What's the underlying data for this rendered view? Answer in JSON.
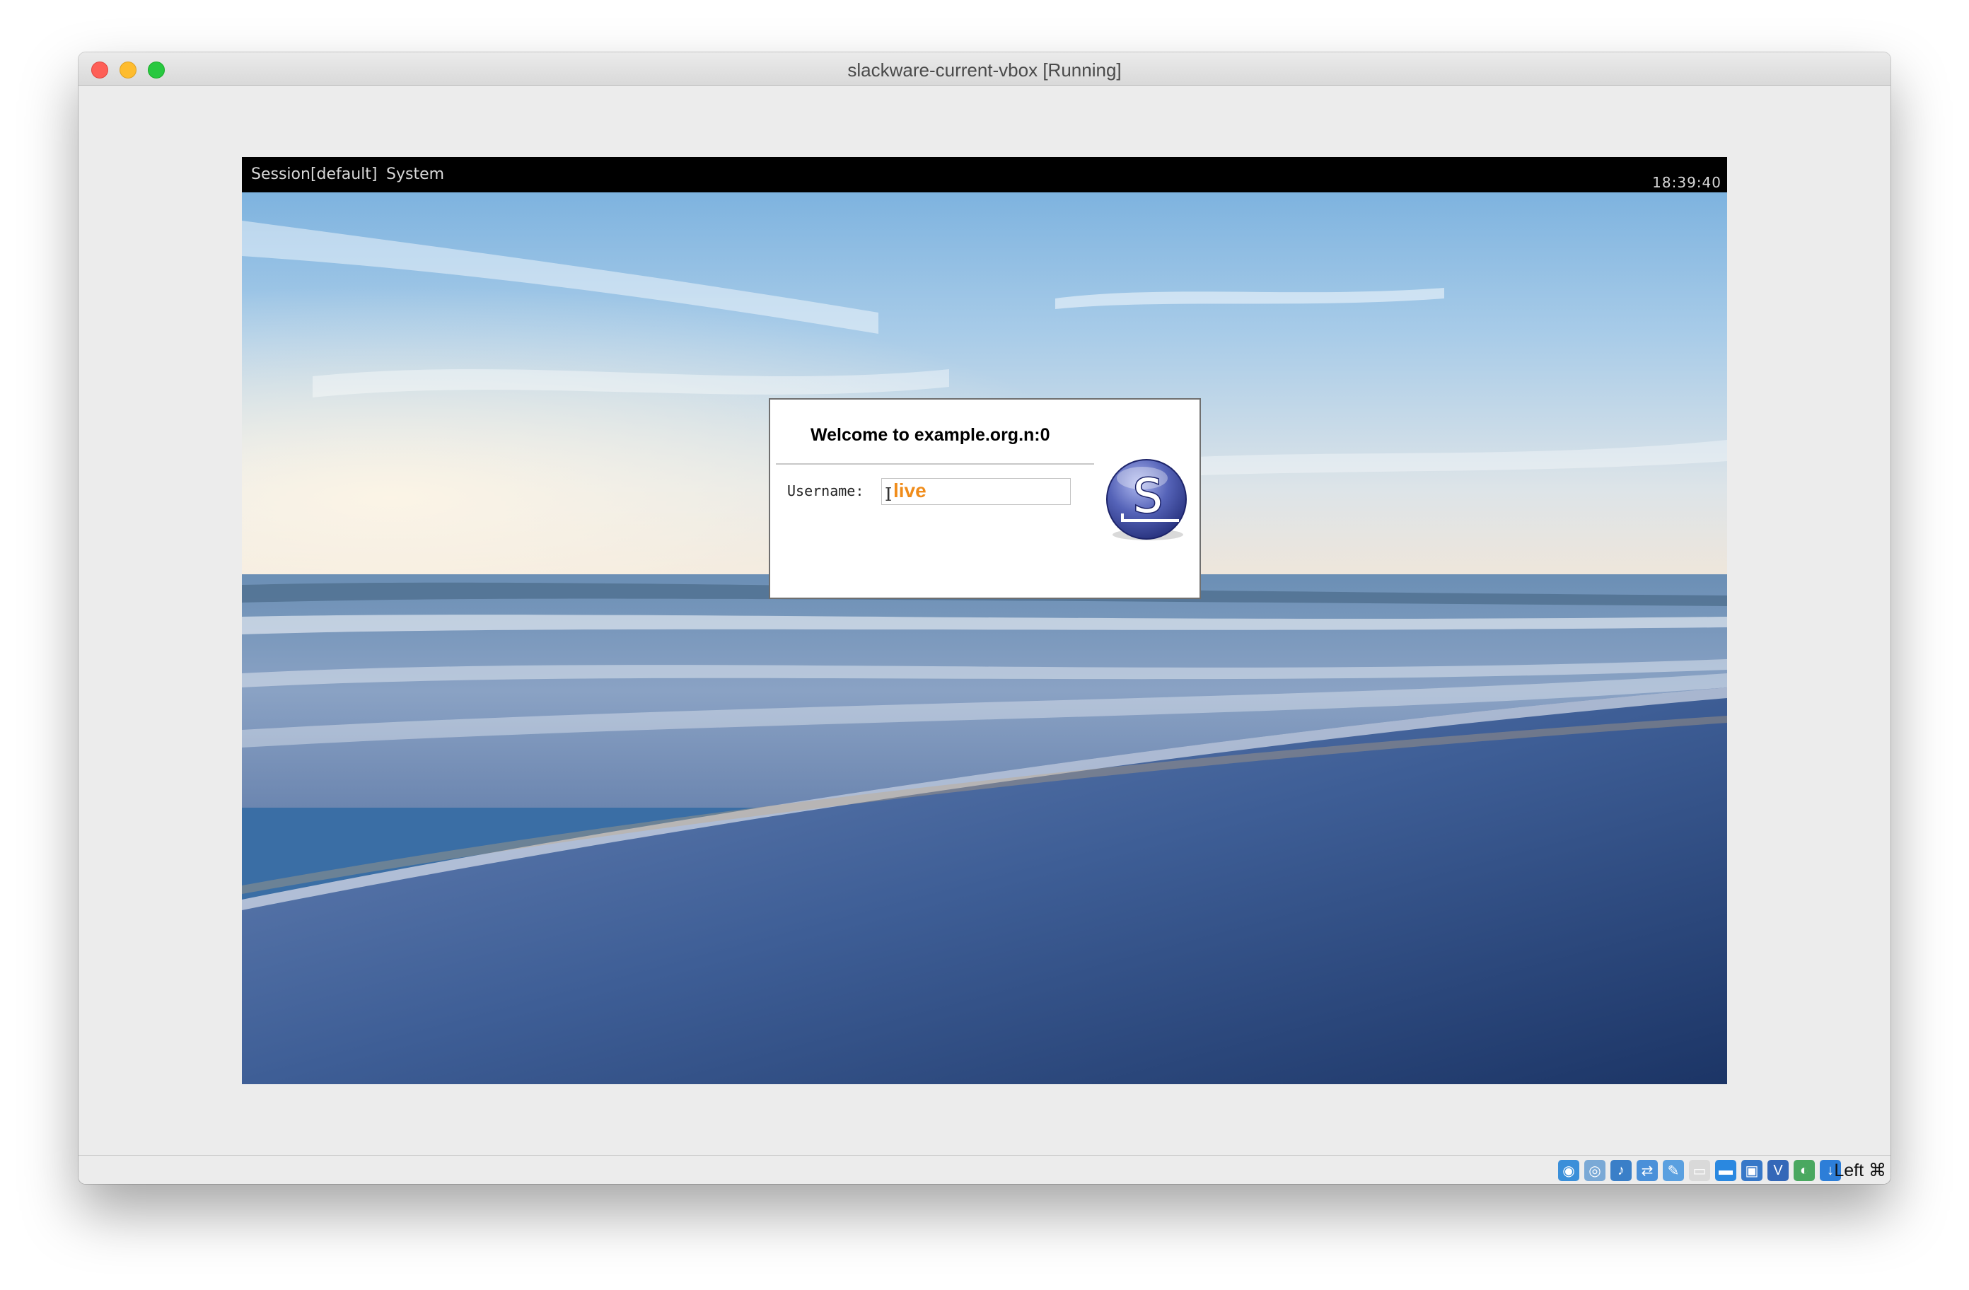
{
  "window": {
    "title": "slackware-current-vbox [Running]"
  },
  "guest": {
    "topbar": {
      "session_label": "Session[default]",
      "system_label": "System",
      "clock": "18:39:40"
    },
    "login": {
      "welcome": "Welcome to example.org.n:0",
      "username_label": "Username:",
      "username_value": "live",
      "username_color": "#f08c1a",
      "logo_icon": "slackware-logo-icon",
      "logo_letter": "S"
    },
    "wallpaper": {
      "description_icon": "beach-wallpaper"
    }
  },
  "statusbar": {
    "icons": [
      {
        "name": "hard-disk-icon",
        "glyph": "◉",
        "color": "#3b8fd9"
      },
      {
        "name": "optical-drive-icon",
        "glyph": "◎",
        "color": "#7aa9d6"
      },
      {
        "name": "audio-icon",
        "glyph": "♪",
        "color": "#3a7fc8"
      },
      {
        "name": "network-icon",
        "glyph": "⇄",
        "color": "#4a90d9"
      },
      {
        "name": "usb-icon",
        "glyph": "✎",
        "color": "#5aa0e0"
      },
      {
        "name": "shared-folders-icon",
        "glyph": "▭",
        "color": "#d9d9d9"
      },
      {
        "name": "display-icon",
        "glyph": "▬",
        "color": "#2a88e0"
      },
      {
        "name": "video-capture-icon",
        "glyph": "▣",
        "color": "#3778c8"
      },
      {
        "name": "virtualization-icon",
        "glyph": "V",
        "color": "#3468b8"
      },
      {
        "name": "mouse-integration-icon",
        "glyph": "◐",
        "color": "#4aa860"
      },
      {
        "name": "keyboard-capture-icon",
        "glyph": "↓",
        "color": "#2d7ed8"
      }
    ],
    "host_key_label": "Left ⌘"
  }
}
